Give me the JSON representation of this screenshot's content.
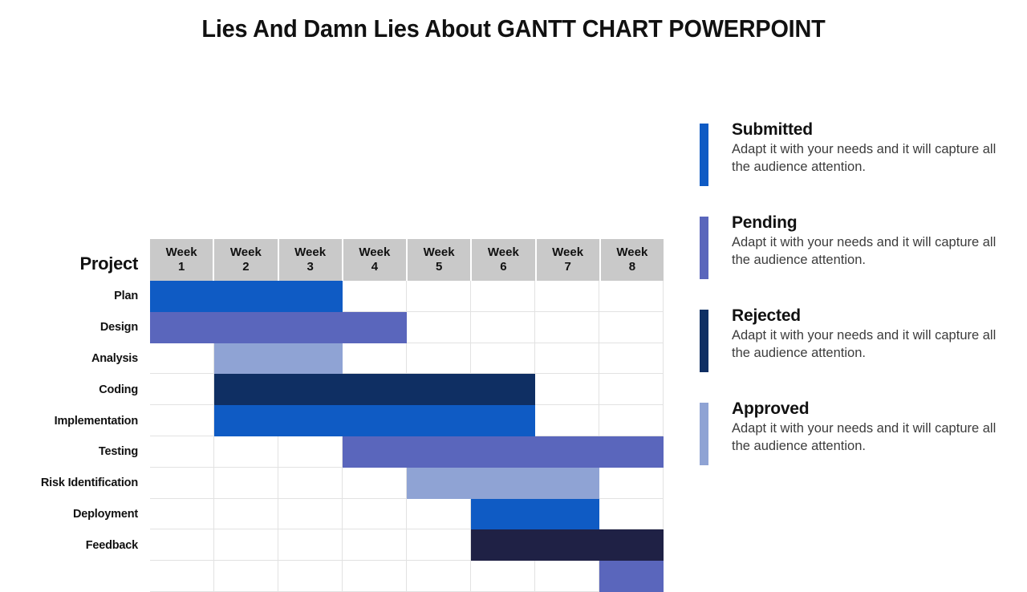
{
  "slide": {
    "title": "Lies And Damn Lies About GANTT CHART POWERPOINT"
  },
  "gantt": {
    "corner_label": "Project",
    "columns": [
      {
        "line1": "Week",
        "line2": "1"
      },
      {
        "line1": "Week",
        "line2": "2"
      },
      {
        "line1": "Week",
        "line2": "3"
      },
      {
        "line1": "Week",
        "line2": "4"
      },
      {
        "line1": "Week",
        "line2": "5"
      },
      {
        "line1": "Week",
        "line2": "6"
      },
      {
        "line1": "Week",
        "line2": "7"
      },
      {
        "line1": "Week",
        "line2": "8"
      }
    ],
    "rows": [
      {
        "label": "Plan"
      },
      {
        "label": "Design"
      },
      {
        "label": "Analysis"
      },
      {
        "label": "Coding"
      },
      {
        "label": "Implementation"
      },
      {
        "label": "Testing"
      },
      {
        "label": "Risk Identification"
      },
      {
        "label": "Deployment"
      },
      {
        "label": "Feedback"
      },
      {
        "label": ""
      }
    ],
    "header_background": "#c9c9c9",
    "gridline_color": "#e2e2e2"
  },
  "chart_data": {
    "type": "bar",
    "title": "Lies And Damn Lies About GANTT CHART POWERPOINT",
    "xlabel": "",
    "ylabel": "Project",
    "categories": [
      "Week 1",
      "Week 2",
      "Week 3",
      "Week 4",
      "Week 5",
      "Week 6",
      "Week 7",
      "Week 8"
    ],
    "xlim": [
      1,
      8
    ],
    "grid": true,
    "legend_position": "right",
    "tasks": [
      {
        "task": "Plan",
        "start_week": 1,
        "end_week": 3,
        "duration": 3,
        "status": "Submitted",
        "color": "#0F5BC4"
      },
      {
        "task": "Design",
        "start_week": 1,
        "end_week": 4,
        "duration": 4,
        "status": "Pending",
        "color": "#5A66BC"
      },
      {
        "task": "Analysis",
        "start_week": 2,
        "end_week": 3,
        "duration": 2,
        "status": "Approved",
        "color": "#8FA3D4"
      },
      {
        "task": "Coding",
        "start_week": 2,
        "end_week": 6,
        "duration": 5,
        "status": "Rejected",
        "color": "#0F2F63"
      },
      {
        "task": "Implementation",
        "start_week": 2,
        "end_week": 6,
        "duration": 5,
        "status": "Submitted",
        "color": "#0F5BC4"
      },
      {
        "task": "Testing",
        "start_week": 4,
        "end_week": 8,
        "duration": 5,
        "status": "Pending",
        "color": "#5A66BC"
      },
      {
        "task": "Risk Identification",
        "start_week": 5,
        "end_week": 7,
        "duration": 3,
        "status": "Approved",
        "color": "#8FA3D4"
      },
      {
        "task": "Deployment",
        "start_week": 6,
        "end_week": 7,
        "duration": 2,
        "status": "Submitted",
        "color": "#0F5BC4"
      },
      {
        "task": "Feedback",
        "start_week": 6,
        "end_week": 8,
        "duration": 3,
        "status": "Rejected",
        "color": "#1F2145"
      },
      {
        "task": "",
        "start_week": 8,
        "end_week": 8,
        "duration": 1,
        "status": "Pending",
        "color": "#5A66BC"
      }
    ]
  },
  "legend": {
    "items": [
      {
        "label": "Submitted",
        "description": "Adapt it with your needs and it will capture all the audience attention.",
        "color": "#0F5BC4"
      },
      {
        "label": "Pending",
        "description": "Adapt it with your needs and it will capture all the audience attention.",
        "color": "#5A66BC"
      },
      {
        "label": "Rejected",
        "description": "Adapt it with your needs and it will capture all the audience attention.",
        "color": "#0F2F63"
      },
      {
        "label": "Approved",
        "description": "Adapt it with your needs and it will capture all the audience attention.",
        "color": "#8FA3D4"
      }
    ]
  }
}
